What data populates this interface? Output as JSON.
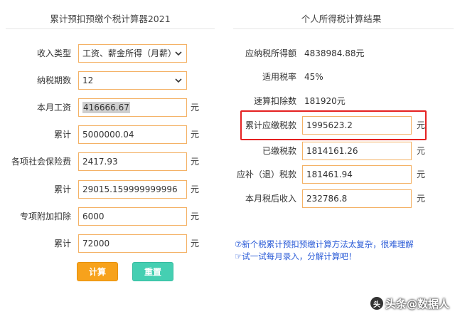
{
  "left": {
    "title": "累计预扣预缴个税计算器2021",
    "fields": [
      {
        "label": "收入类型",
        "value": "工资、薪金所得（月薪）",
        "kind": "select",
        "unit": ""
      },
      {
        "label": "纳税期数",
        "value": "12",
        "kind": "select",
        "unit": ""
      },
      {
        "label": "本月工资",
        "value": "416666.67",
        "kind": "input-selected",
        "unit": "元"
      },
      {
        "label": "累计",
        "value": "5000000.04",
        "kind": "input",
        "unit": "元"
      },
      {
        "label": "各项社会保险费",
        "value": "2417.93",
        "kind": "input",
        "unit": "元"
      },
      {
        "label": "累计",
        "value": "29015.159999999996",
        "kind": "input",
        "unit": "元"
      },
      {
        "label": "专项附加扣除",
        "value": "6000",
        "kind": "input",
        "unit": "元"
      },
      {
        "label": "累计",
        "value": "72000",
        "kind": "input",
        "unit": "元"
      }
    ],
    "calc_button": "计算",
    "reset_button": "重置"
  },
  "right": {
    "title": "个人所得税计算结果",
    "plain_rows": [
      {
        "label": "应纳税所得额",
        "value": "4838984.88元"
      },
      {
        "label": "适用税率",
        "value": "45%"
      },
      {
        "label": "速算扣除数",
        "value": "181920元"
      }
    ],
    "field_rows": [
      {
        "label": "累计应缴税款",
        "value": "1995623.2",
        "unit": "元"
      },
      {
        "label": "已缴税款",
        "value": "1814161.26",
        "unit": "元"
      },
      {
        "label": "应补（退）税款",
        "value": "181461.94",
        "unit": "元"
      },
      {
        "label": "本月税后收入",
        "value": "232786.8",
        "unit": "元"
      }
    ]
  },
  "help": {
    "line1": "⑦新个税累计预扣预缴计算方法太复杂，很难理解",
    "line2": "☞试一试每月录入，分解计算吧！"
  },
  "watermark": {
    "text": "头条@数据人",
    "logo": "头"
  },
  "colors": {
    "field_border": "#f4b266",
    "calc_button": "#f7a21c",
    "reset_button": "#45cfb2",
    "highlight_box": "#e52121",
    "help_text": "#2a5bd7"
  }
}
